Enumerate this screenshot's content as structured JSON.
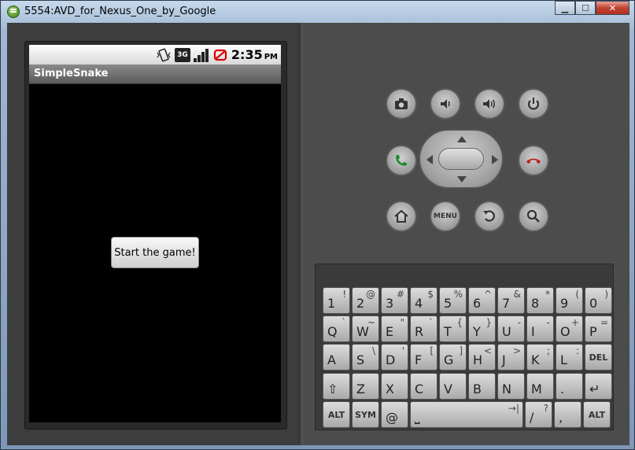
{
  "window": {
    "title": "5554:AVD_for_Nexus_One_by_Google",
    "controls": [
      "minimize",
      "maximize",
      "close"
    ]
  },
  "statusbar": {
    "net_label": "3G",
    "time": "2:35",
    "ampm": "PM"
  },
  "app": {
    "title": "SimpleSnake",
    "start_button": "Start the game!"
  },
  "controls": {
    "menu_label": "MENU",
    "icons": [
      "camera-icon",
      "volume-down-icon",
      "volume-up-icon",
      "power-icon",
      "call-icon",
      "end-call-icon",
      "home-icon",
      "menu-icon",
      "back-icon",
      "search-icon"
    ]
  },
  "keyboard": {
    "rows": [
      [
        {
          "main": "1",
          "alt": "!"
        },
        {
          "main": "2",
          "alt": "@"
        },
        {
          "main": "3",
          "alt": "#"
        },
        {
          "main": "4",
          "alt": "$"
        },
        {
          "main": "5",
          "alt": "%"
        },
        {
          "main": "6",
          "alt": "^"
        },
        {
          "main": "7",
          "alt": "&"
        },
        {
          "main": "8",
          "alt": "*"
        },
        {
          "main": "9",
          "alt": "("
        },
        {
          "main": "0",
          "alt": ")"
        }
      ],
      [
        {
          "main": "Q",
          "alt": "`"
        },
        {
          "main": "W",
          "alt": "~"
        },
        {
          "main": "E",
          "alt": "\""
        },
        {
          "main": "R",
          "alt": "`"
        },
        {
          "main": "T",
          "alt": "{"
        },
        {
          "main": "Y",
          "alt": "}"
        },
        {
          "main": "U",
          "alt": "-"
        },
        {
          "main": "I",
          "alt": "-"
        },
        {
          "main": "O",
          "alt": "+"
        },
        {
          "main": "P",
          "alt": "="
        }
      ],
      [
        {
          "main": "A",
          "alt": ""
        },
        {
          "main": "S",
          "alt": "\\"
        },
        {
          "main": "D",
          "alt": "'"
        },
        {
          "main": "F",
          "alt": "["
        },
        {
          "main": "G",
          "alt": "]"
        },
        {
          "main": "H",
          "alt": "<"
        },
        {
          "main": "J",
          "alt": ">"
        },
        {
          "main": "K",
          "alt": ";"
        },
        {
          "main": "L",
          "alt": ":"
        },
        {
          "main": "DEL",
          "alt": ""
        }
      ],
      [
        {
          "main": "⇧",
          "alt": ""
        },
        {
          "main": "Z",
          "alt": ""
        },
        {
          "main": "X",
          "alt": ""
        },
        {
          "main": "C",
          "alt": ""
        },
        {
          "main": "V",
          "alt": ""
        },
        {
          "main": "B",
          "alt": ""
        },
        {
          "main": "N",
          "alt": ""
        },
        {
          "main": "M",
          "alt": ""
        },
        {
          "main": ".",
          "alt": ""
        },
        {
          "main": "↵",
          "alt": ""
        }
      ],
      [
        {
          "main": "ALT",
          "alt": ""
        },
        {
          "main": "SYM",
          "alt": ""
        },
        {
          "main": "@",
          "alt": ""
        },
        {
          "main": "⎵",
          "alt": "→|"
        },
        {
          "main": "/",
          "alt": "?"
        },
        {
          "main": ",",
          "alt": ""
        },
        {
          "main": "ALT",
          "alt": ""
        }
      ]
    ]
  }
}
